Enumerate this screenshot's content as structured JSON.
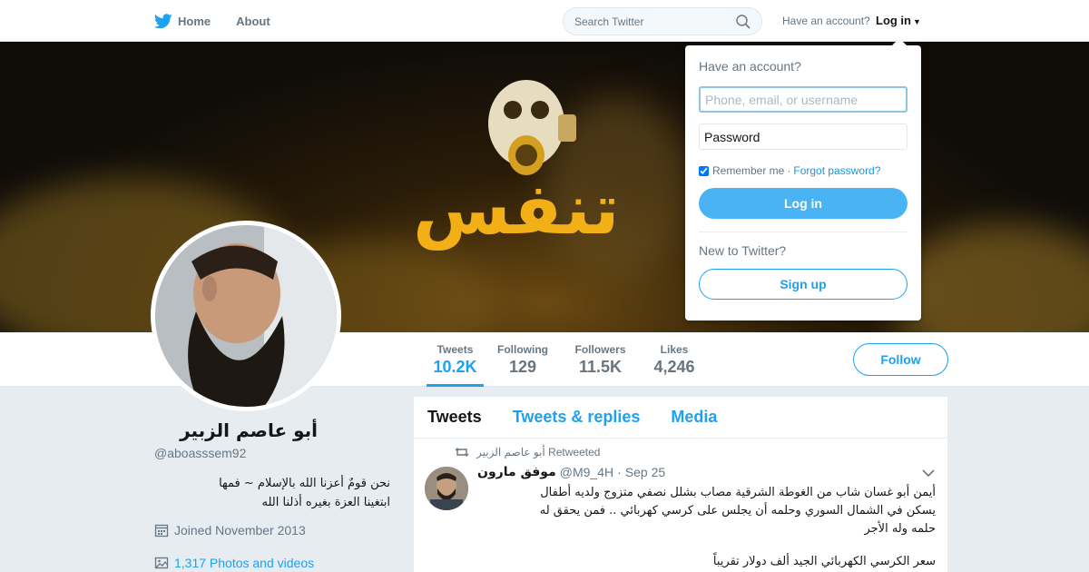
{
  "nav": {
    "home_label": "Home",
    "about_label": "About",
    "search_placeholder": "Search Twitter",
    "have_account": "Have an account?",
    "login_label": "Log in"
  },
  "banner": {
    "word": "تنفس"
  },
  "profile": {
    "name": "أبو عاصم الزبير",
    "handle": "@aboasssem92",
    "bio_line1": "نحن قومٌ أعزنا الله بالإسلام ~ فمها",
    "bio_line2": "ابتغينا العزة بغيره أذلنا الله",
    "joined": "Joined November 2013",
    "photos": "1,317 Photos and videos"
  },
  "stats": [
    {
      "label": "Tweets",
      "value": "10.2K"
    },
    {
      "label": "Following",
      "value": "129"
    },
    {
      "label": "Followers",
      "value": "11.5K"
    },
    {
      "label": "Likes",
      "value": "4,246"
    }
  ],
  "follow_label": "Follow",
  "timeline": {
    "tabs": [
      "Tweets",
      "Tweets & replies",
      "Media"
    ],
    "tweet": {
      "retweeted_by": "أبو عاصم الزبير Retweeted",
      "author_name": "موفق مارون",
      "author_handle": "@M9_4H",
      "date": "Sep 25",
      "text_lines": [
        "أيمن أبو غسان شاب من الغوطة الشرقية مصاب بشلل نصفي متزوج ولديه أطفال",
        "يسكن في الشمال السوري وحلمه أن يجلس على كرسي كهربائي .. فمن يحقق له",
        "حلمه وله الأجر"
      ],
      "text_line4": "سعر الكرسي الكهربائي الجيد ألف دولار تقريباً"
    }
  },
  "login_dropdown": {
    "title": "Have an account?",
    "username_placeholder": "Phone, email, or username",
    "password_placeholder": "Password",
    "remember": "Remember me",
    "separator": "·",
    "forgot": "Forgot password?",
    "login_button": "Log in",
    "new_prompt": "New to Twitter?",
    "signup_button": "Sign up"
  },
  "colors": {
    "accent": "#1da1f2",
    "banner_yellow": "#f2b016"
  }
}
